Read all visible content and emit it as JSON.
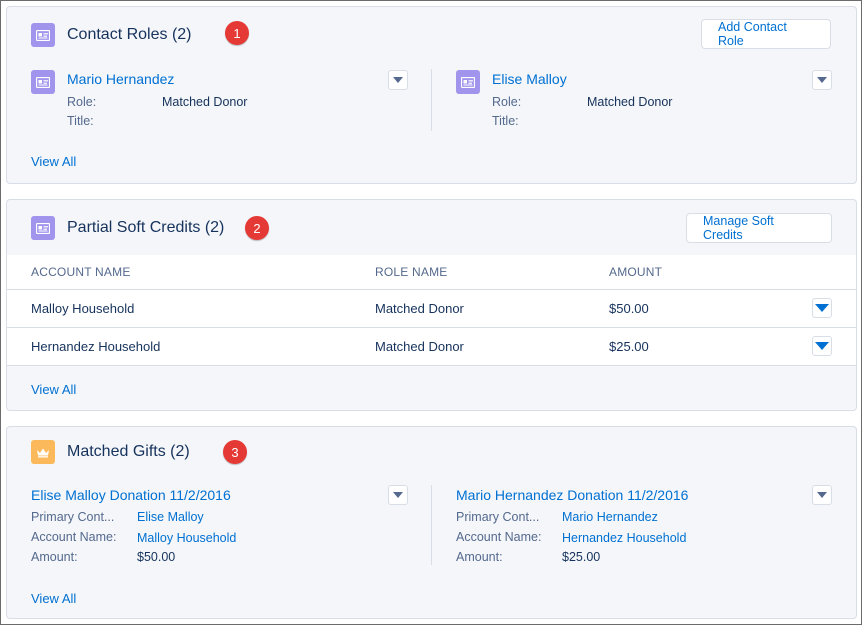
{
  "contact_roles": {
    "title": "Contact Roles (2)",
    "badge": "1",
    "add_button": "Add Contact Role",
    "view_all": "View All",
    "items": [
      {
        "name": "Mario Hernandez",
        "role_label": "Role:",
        "role": "Matched Donor",
        "title_label": "Title:",
        "title": ""
      },
      {
        "name": "Elise Malloy",
        "role_label": "Role:",
        "role": "Matched Donor",
        "title_label": "Title:",
        "title": ""
      }
    ]
  },
  "soft_credits": {
    "title": "Partial Soft Credits (2)",
    "badge": "2",
    "manage_button": "Manage Soft Credits",
    "view_all": "View All",
    "columns": [
      "ACCOUNT NAME",
      "ROLE NAME",
      "AMOUNT"
    ],
    "rows": [
      {
        "account": "Malloy Household",
        "role": "Matched Donor",
        "amount": "$50.00"
      },
      {
        "account": "Hernandez Household",
        "role": "Matched Donor",
        "amount": "$25.00"
      }
    ]
  },
  "matched_gifts": {
    "title": "Matched Gifts (2)",
    "badge": "3",
    "view_all": "View All",
    "items": [
      {
        "name": "Elise Malloy Donation 11/2/2016",
        "primary_label": "Primary Cont...",
        "primary": "Elise Malloy",
        "account_label": "Account Name:",
        "account": "Malloy Household",
        "amount_label": "Amount:",
        "amount": "$50.00"
      },
      {
        "name": "Mario Hernandez Donation 11/2/2016",
        "primary_label": "Primary Cont...",
        "primary": "Mario Hernandez",
        "account_label": "Account Name:",
        "account": "Hernandez Household",
        "amount_label": "Amount:",
        "amount": "$25.00"
      }
    ]
  },
  "colors": {
    "link": "#0070d2",
    "contact_icon": "#a094ed",
    "gift_icon": "#fcb95b",
    "badge": "#e53935"
  },
  "icons": {
    "contact": "contact-card-icon",
    "gift": "crown-icon",
    "menu": "chevron-down-icon"
  }
}
